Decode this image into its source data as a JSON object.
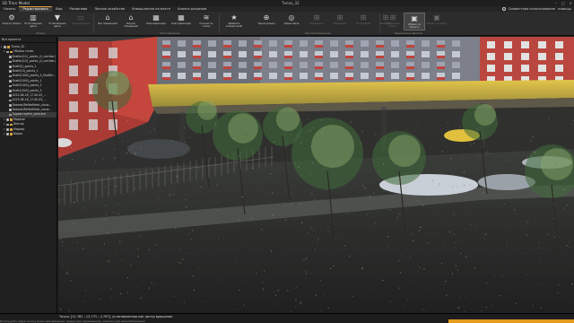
{
  "window": {
    "app_title": "3D Trion Model",
    "doc_title": "Тепло_32",
    "controls": [
      "–",
      "□",
      "×"
    ]
  },
  "menu": {
    "tabs": [
      "Начать",
      "Редактировать",
      "Вид",
      "Разлинова",
      "Лесное хозяйство",
      "Измышления на масте",
      "Анализ разделов"
    ],
    "active_index": 1,
    "right_label": "Совместная использование",
    "right_extra": "помощь"
  },
  "ribbon": {
    "buttons": [
      {
        "label": "Фильтр облака",
        "icon": "⚙",
        "disabled": false
      },
      {
        "label": "Естественные цвета",
        "icon": "▥",
        "disabled": false
      },
      {
        "label": "Установление цвета",
        "icon": "▼",
        "disabled": false
      },
      {
        "label": "Произвольный",
        "icon": "▭",
        "disabled": true
      },
      {
        "label": "Все помещений",
        "icon": "⌂",
        "disabled": false
      },
      {
        "label": "Внутри помещений",
        "icon": "⌂",
        "disabled": false
      },
      {
        "label": "Классификация",
        "icon": "▦",
        "disabled": false
      },
      {
        "label": "Классификация",
        "icon": "▦",
        "disabled": false
      },
      {
        "label": "Сложность этажа",
        "icon": "≋",
        "disabled": false
      },
      {
        "label": "Добавить комментарий",
        "icon": "★",
        "disabled": false
      },
      {
        "label": "Триангуляция",
        "icon": "⊕",
        "disabled": false
      },
      {
        "label": "Ориентиров",
        "icon": "◎",
        "disabled": false
      },
      {
        "label": "Измерение",
        "icon": "⊞",
        "disabled": true
      },
      {
        "label": "Измерение",
        "icon": "⊞",
        "disabled": true
      },
      {
        "label": "Построение",
        "icon": "⊞",
        "disabled": true
      },
      {
        "label": "Выбрать",
        "icon": "⊞",
        "disabled": true
      },
      {
        "label": "Выбранный объект",
        "icon": "⊞",
        "disabled": true
      },
      {
        "label": "Облако по объекту",
        "icon": "▣",
        "disabled": false
      },
      {
        "label": "Облако по цвету",
        "icon": "▣",
        "disabled": true
      }
    ],
    "group_labels": [
      "Облака",
      "Классификация",
      "Перспективный вид",
      "Выделенные объекты"
    ]
  },
  "left_panel": {
    "header": "Все проекта",
    "items": [
      {
        "label": "Тепло_32",
        "depth": 0,
        "type": "folder",
        "checked": true
      },
      {
        "label": "Облака точек",
        "depth": 1,
        "type": "folder",
        "checked": true
      },
      {
        "label": "Shafter(11)_points_(1_corridor)",
        "depth": 2,
        "type": "item",
        "checked": true
      },
      {
        "label": "Shafter(12)_points_(2_corridor)",
        "depth": 2,
        "type": "item",
        "checked": true
      },
      {
        "label": "Shaft(2)_points_1",
        "depth": 2,
        "type": "item",
        "checked": true
      },
      {
        "label": "Shaft(13)_points_1",
        "depth": 2,
        "type": "item",
        "checked": true
      },
      {
        "label": "Shaft(1040)_points_3_Shaftle...",
        "depth": 2,
        "type": "item",
        "checked": true
      },
      {
        "label": "Shaft(1040)_points_1",
        "depth": 2,
        "type": "item",
        "checked": true
      },
      {
        "label": "Shaft(1040)_points_2",
        "depth": 2,
        "type": "item",
        "checked": true
      },
      {
        "label": "Shaft(1040)_points_3",
        "depth": 2,
        "type": "item",
        "checked": true
      },
      {
        "label": "2023-08-18_17-40-43_...",
        "depth": 2,
        "type": "item",
        "checked": true
      },
      {
        "label": "2023-08-18_17-40-43_...",
        "depth": 2,
        "type": "item",
        "checked": true
      },
      {
        "label": "Dataset/ReflexMesh_cloud...",
        "depth": 2,
        "type": "item",
        "checked": true
      },
      {
        "label": "Dataset/ReflexMesh_cloud...",
        "depth": 2,
        "type": "item",
        "checked": true
      },
      {
        "label": "Здравствуйте_selected",
        "depth": 2,
        "type": "item",
        "checked": true,
        "selected": true
      },
      {
        "label": "Модели",
        "depth": 1,
        "type": "folder",
        "checked": true
      },
      {
        "label": "Вектор",
        "depth": 1,
        "type": "folder",
        "checked": true
      },
      {
        "label": "Маркер",
        "depth": 1,
        "type": "folder",
        "checked": true
      },
      {
        "label": "Видео",
        "depth": 1,
        "type": "folder",
        "checked": true
      }
    ]
  },
  "status": {
    "main": "Точка: [11.761 ; 13.771 ; 2.797], установленная как центр вращения",
    "hint": "Используйте левую кнопку мыши для вращения, правую для перемещения, колесико для масштабирования",
    "progress": 1.0
  },
  "colors": {
    "accent": "#e0a13a",
    "progress": "#e59b1b",
    "facade_brick": "#c0433c",
    "canopy_yellow": "#d9b43a"
  }
}
